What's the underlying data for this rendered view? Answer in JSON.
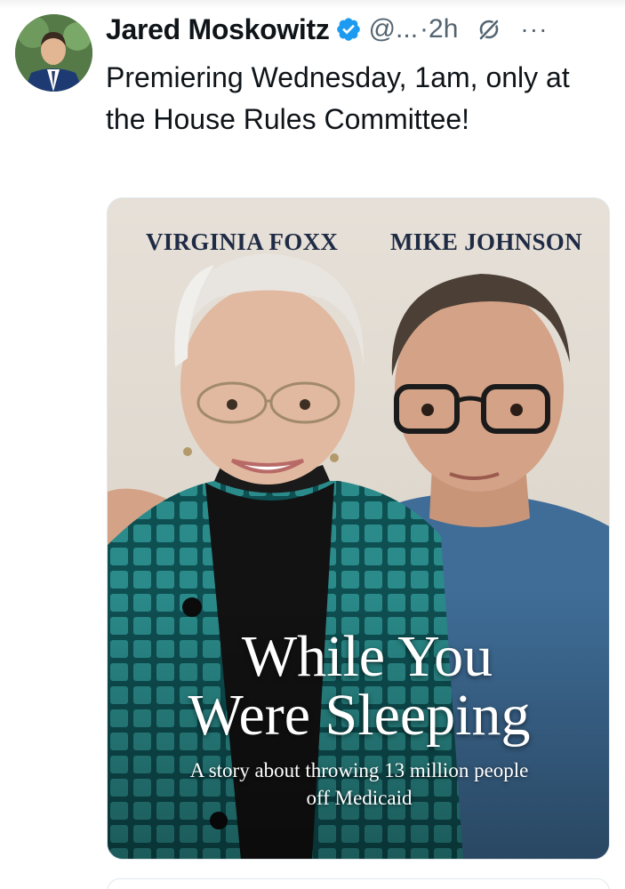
{
  "post": {
    "author_name": "Jared Moskowitz",
    "handle": "@...",
    "separator": "·",
    "time": "2h",
    "more_label": "···",
    "text": "Premiering Wednesday, 1am, only at the House Rules Committee!",
    "icons": {
      "verified": "verified-badge-icon",
      "grok": "grok-icon",
      "more": "more-icon"
    }
  },
  "media": {
    "cover": {
      "name_left": "VIRGINIA FOXX",
      "name_right": "MIKE JOHNSON",
      "title_line1": "While You",
      "title_line2": "Were Sleeping",
      "subtitle_line1": "A story about throwing 13 million people",
      "subtitle_line2": "off Medicaid"
    }
  },
  "colors": {
    "verified": "#1d9bf0",
    "secondary_text": "#536471",
    "primary_text": "#0f1419",
    "cover_name": "#1f2b45"
  }
}
